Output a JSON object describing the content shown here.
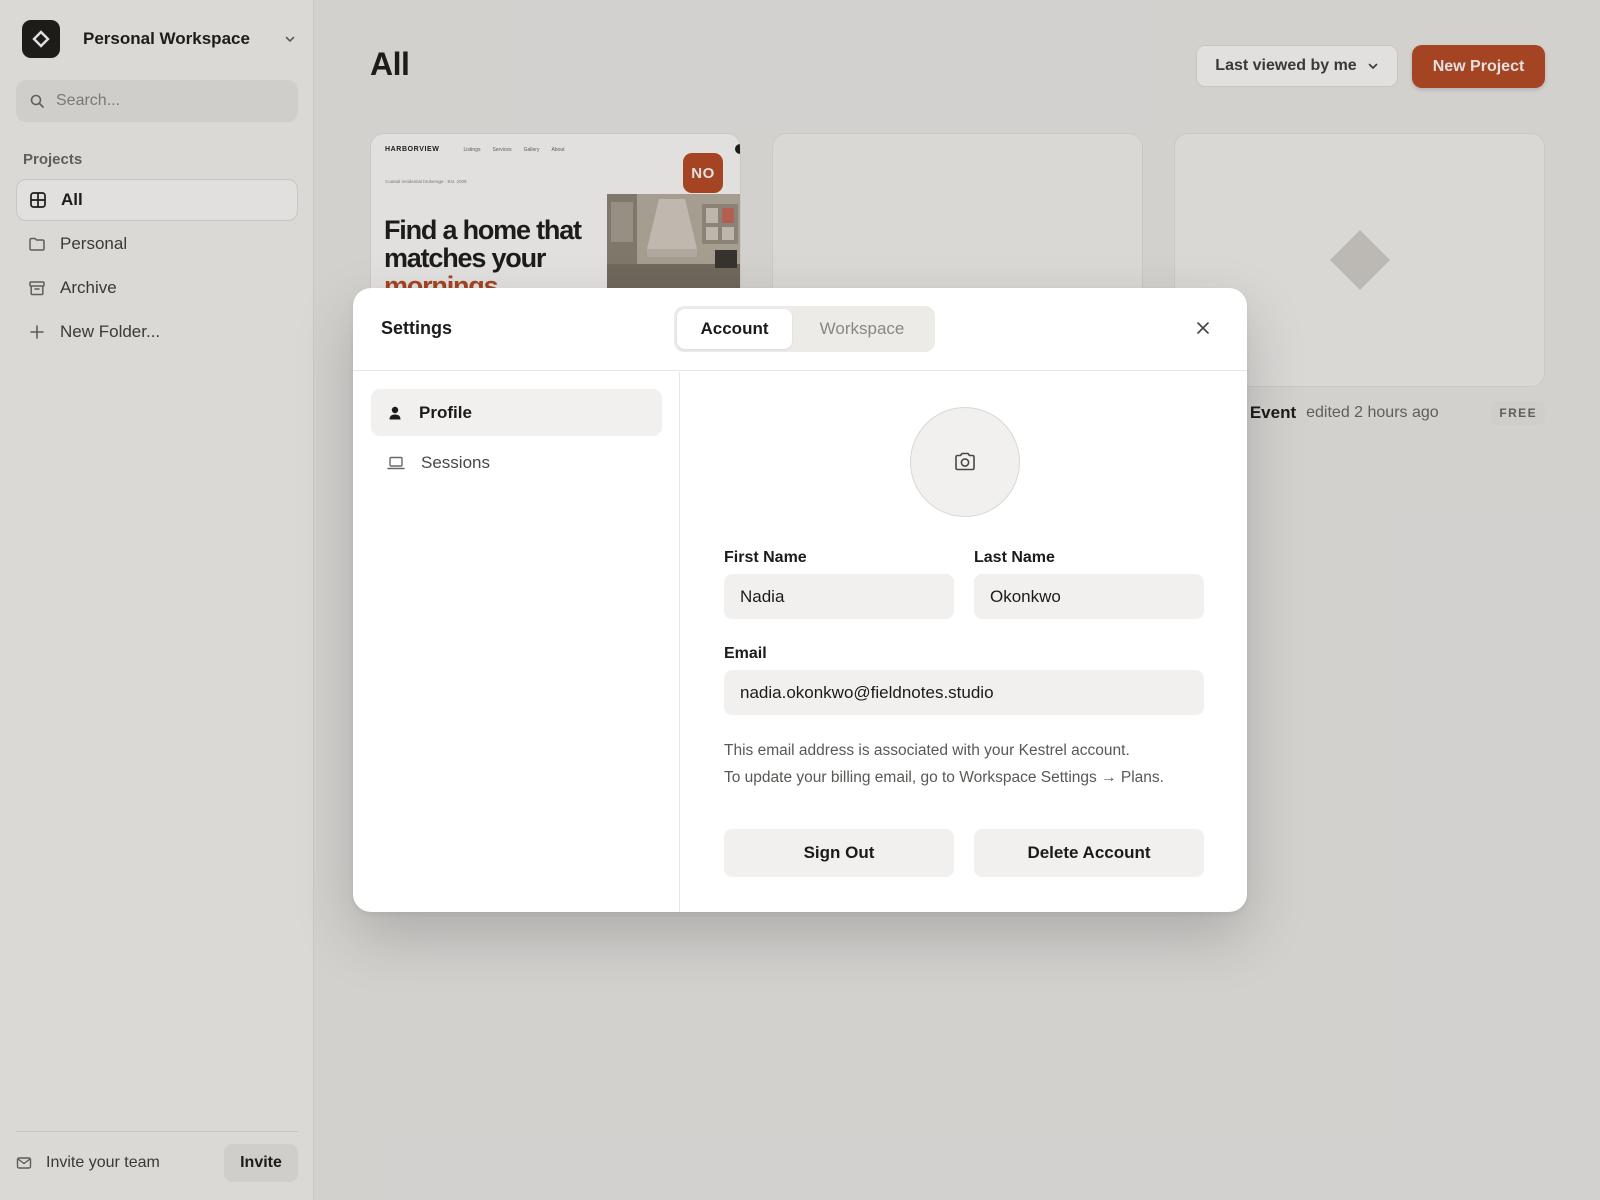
{
  "sidebar": {
    "workspace_name": "Personal Workspace",
    "search_placeholder": "Search...",
    "section_label": "Projects",
    "items": [
      {
        "label": "All",
        "icon": "grid-icon",
        "active": true
      },
      {
        "label": "Personal",
        "icon": "folder-icon"
      },
      {
        "label": "Archive",
        "icon": "archive-icon"
      },
      {
        "label": "New Folder...",
        "icon": "plus-icon"
      }
    ],
    "footer": {
      "invite_text": "Invite your team",
      "invite_button": "Invite"
    }
  },
  "main": {
    "title": "All",
    "sort_label": "Last viewed by me",
    "new_project_label": "New Project",
    "thumbnail": {
      "brand": "HARBORVIEW",
      "links": [
        "Listings",
        "Services",
        "Gallery",
        "About"
      ],
      "tagline": "Coastal residential brokerage · Est. 2009",
      "hero_line1": "Find a home that",
      "hero_line2": "matches your",
      "hero_line3": "mornings",
      "avatar_initials": "NO"
    },
    "card_meta": {
      "name": "ld Event",
      "edited": "edited 2 hours ago",
      "badge": "FREE"
    }
  },
  "modal": {
    "title": "Settings",
    "tabs": [
      "Account",
      "Workspace"
    ],
    "side_items": [
      {
        "label": "Profile",
        "icon": "user-icon",
        "active": true
      },
      {
        "label": "Sessions",
        "icon": "laptop-icon"
      }
    ],
    "first_name_label": "First Name",
    "first_name": "Nadia",
    "last_name_label": "Last Name",
    "last_name": "Okonkwo",
    "email_label": "Email",
    "email": "nadia.okonkwo@fieldnotes.studio",
    "help_line1": "This email address is associated with your Kestrel account.",
    "help_line2": "To update your billing email, go to Workspace Settings → Plans.",
    "sign_out": "Sign Out",
    "delete_account": "Delete Account"
  },
  "colors": {
    "accent": "#b84a24",
    "background": "#f7f7f5",
    "modal_bg": "#ffffff"
  }
}
